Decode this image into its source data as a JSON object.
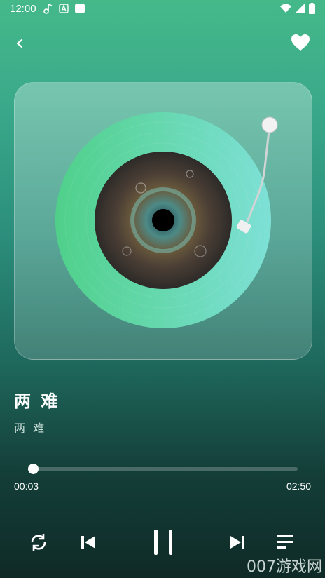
{
  "status_bar": {
    "time": "12:00",
    "left_icons": [
      "music-note-icon",
      "letter-a-icon",
      "square-icon"
    ],
    "right_icons": [
      "wifi-icon",
      "signal-icon",
      "battery-icon"
    ]
  },
  "top_bar": {
    "back_icon": "chevron-left-icon",
    "favorite_icon": "heart-icon"
  },
  "player": {
    "title": "两 难",
    "artist": "两 难",
    "current_time": "00:03",
    "total_time": "02:50",
    "progress": 0.018
  },
  "controls": {
    "icons": [
      "repeat-icon",
      "previous-icon",
      "pause-icon",
      "next-icon",
      "playlist-icon"
    ]
  },
  "watermark": "007游戏网",
  "colors": {
    "vinyl_green": "#5fd4a0",
    "vinyl_teal": "#6fe0d0",
    "background_top": "#45b98a",
    "background_bottom": "#0f2a27"
  }
}
